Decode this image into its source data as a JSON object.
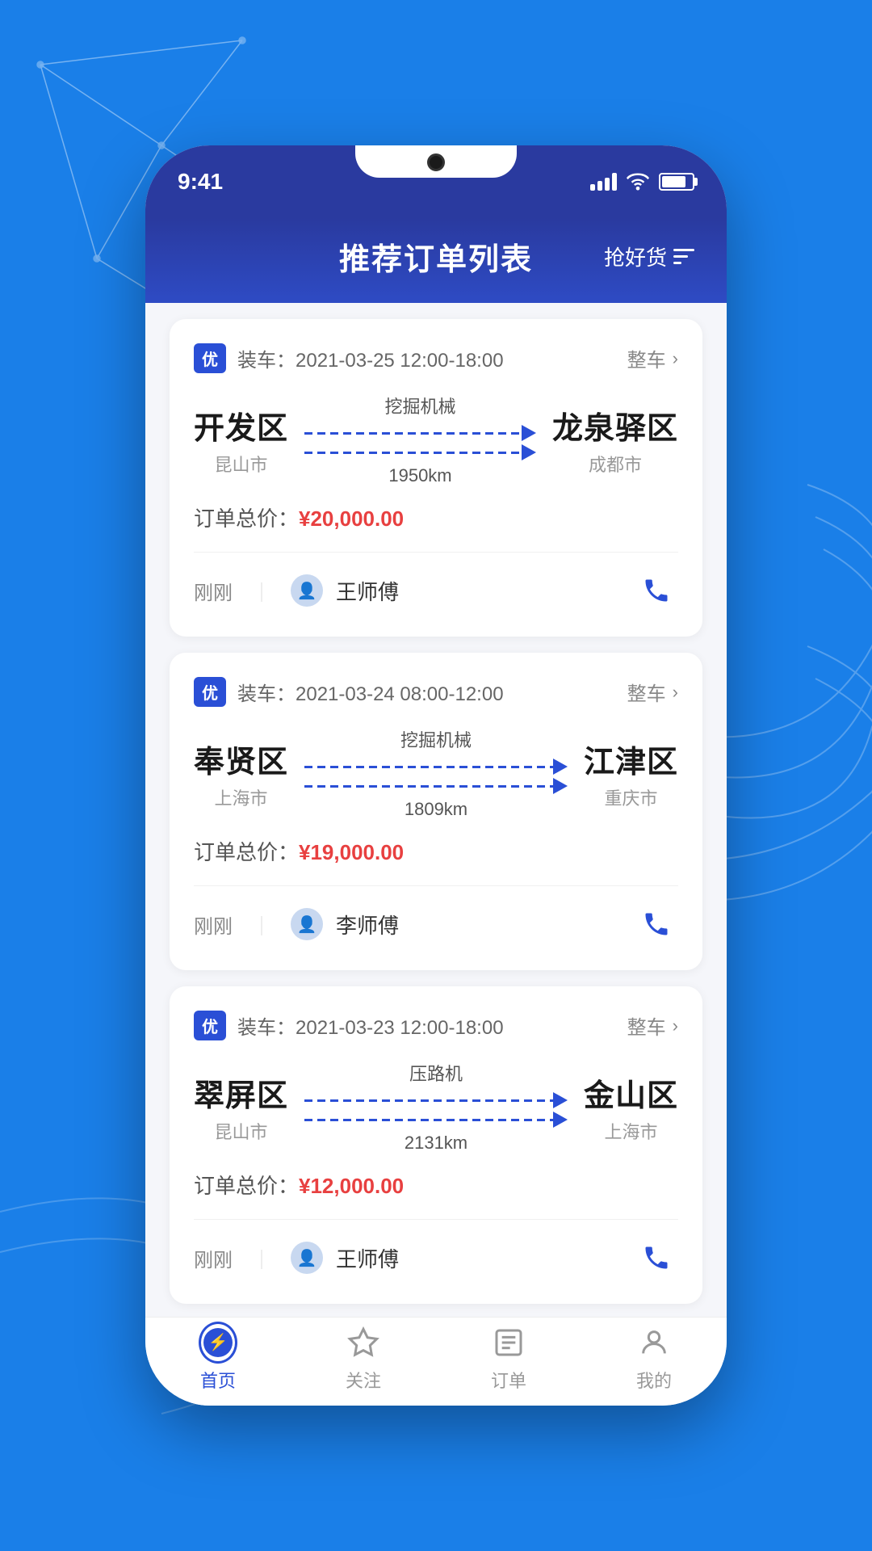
{
  "background": {
    "color": "#1a7fe8"
  },
  "status_bar": {
    "time": "9:41",
    "signal": "4 bars",
    "wifi": true,
    "battery": "full"
  },
  "header": {
    "title": "推荐订单列表",
    "action_label": "抢好货"
  },
  "orders": [
    {
      "id": "order-1",
      "badge": "优",
      "load_time": "装车：2021-03-25 12:00-18:00",
      "type_label": "整车",
      "origin_city": "开发区",
      "origin_sub": "昆山市",
      "goods_type": "挖掘机械",
      "distance": "1950km",
      "dest_city": "龙泉驿区",
      "dest_sub": "成都市",
      "price_label": "订单总价：",
      "price_value": "¥20,000.00",
      "driver_time": "刚刚",
      "driver_name": "王师傅"
    },
    {
      "id": "order-2",
      "badge": "优",
      "load_time": "装车：2021-03-24 08:00-12:00",
      "type_label": "整车",
      "origin_city": "奉贤区",
      "origin_sub": "上海市",
      "goods_type": "挖掘机械",
      "distance": "1809km",
      "dest_city": "江津区",
      "dest_sub": "重庆市",
      "price_label": "订单总价：",
      "price_value": "¥19,000.00",
      "driver_time": "刚刚",
      "driver_name": "李师傅"
    },
    {
      "id": "order-3",
      "badge": "优",
      "load_time": "装车：2021-03-23 12:00-18:00",
      "type_label": "整车",
      "origin_city": "翠屏区",
      "origin_sub": "昆山市",
      "goods_type": "压路机",
      "distance": "2131km",
      "dest_city": "金山区",
      "dest_sub": "上海市",
      "price_label": "订单总价：",
      "price_value": "¥12,000.00",
      "driver_time": "刚刚",
      "driver_name": "王师傅"
    }
  ],
  "bottom_nav": [
    {
      "id": "home",
      "label": "首页",
      "active": true
    },
    {
      "id": "follow",
      "label": "关注",
      "active": false
    },
    {
      "id": "orders",
      "label": "订单",
      "active": false
    },
    {
      "id": "mine",
      "label": "我的",
      "active": false
    }
  ]
}
